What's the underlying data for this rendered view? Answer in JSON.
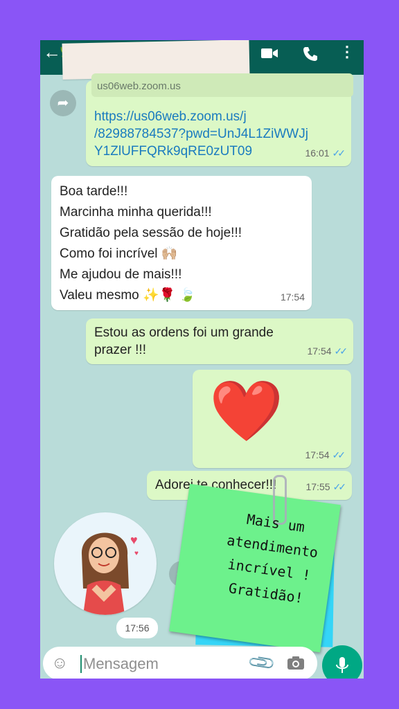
{
  "header": {
    "back_icon": "arrow-left-icon",
    "video_icon": "video-call-icon",
    "call_icon": "phone-icon",
    "more_icon": "more-vertical-icon"
  },
  "messages": [
    {
      "preview_domain": "us06web.zoom.us",
      "link_lines": [
        "https://us06web.zoom.us/j",
        "/82988784537?pwd=UnJ4L1ZiWWJj",
        "Y1ZlUFFQRk9qRE0zUT09"
      ],
      "time": "16:01"
    },
    {
      "lines": [
        "Boa tarde!!!",
        "Marcinha minha querida!!!",
        "Gratidão pela sessão de hoje!!!",
        "Como foi incrível 🙌🏼",
        "Me ajudou de mais!!!",
        "Valeu mesmo ✨🌹 🍃"
      ],
      "time": "17:54"
    },
    {
      "lines": [
        "Estou as ordens foi um grande",
        "prazer !!!"
      ],
      "time": "17:54"
    },
    {
      "emoji": "❤️",
      "time": "17:54"
    },
    {
      "text": "Adorei te conhecer!!!",
      "time": "17:55"
    }
  ],
  "sticker": {
    "time": "17:56"
  },
  "note": {
    "lines": [
      "Mais um",
      "atendimento",
      "incrível !",
      "Gratidão!"
    ]
  },
  "input": {
    "placeholder": "Mensagem"
  },
  "colors": {
    "frame": "#8a55f6",
    "header": "#075e54",
    "outgoing": "#dcf8c6",
    "incoming": "#ffffff",
    "note_green": "#6df18c",
    "note_blue": "#35d5f7"
  }
}
